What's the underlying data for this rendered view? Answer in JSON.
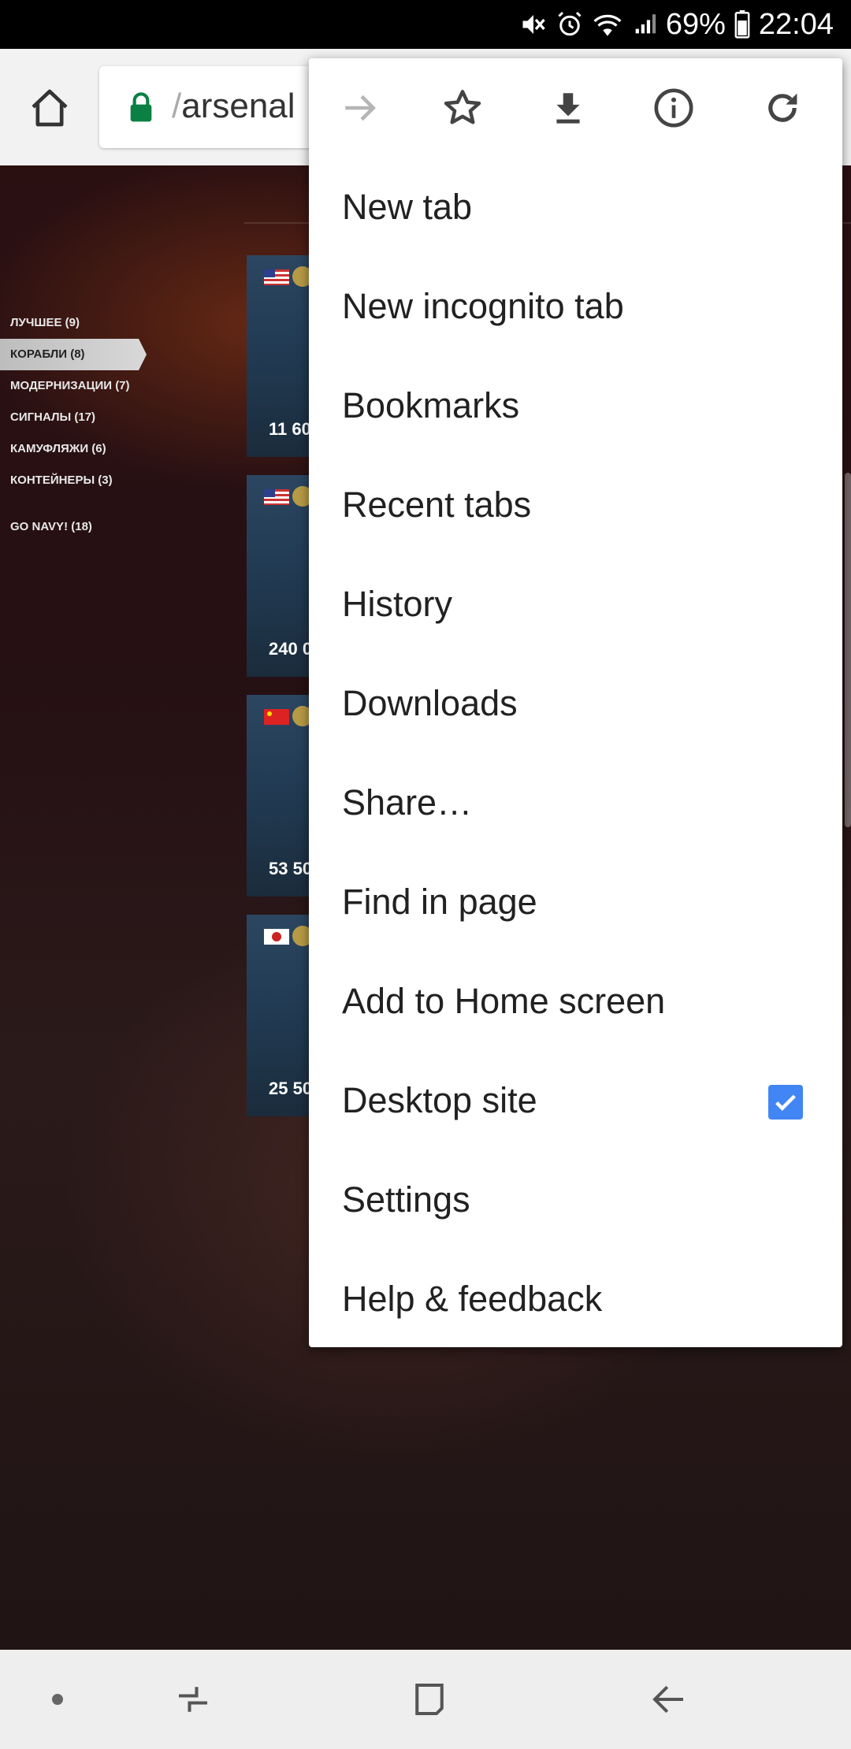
{
  "status": {
    "battery": "69%",
    "time": "22:04"
  },
  "toolbar": {
    "url_prefix": "/",
    "url_rest": "arsenal"
  },
  "page": {
    "categories": [
      {
        "label": "ЛУЧШЕЕ (9)",
        "active": false
      },
      {
        "label": "КОРАБЛИ (8)",
        "active": true
      },
      {
        "label": "МОДЕРНИЗАЦИИ (7)",
        "active": false
      },
      {
        "label": "СИГНАЛЫ (17)",
        "active": false
      },
      {
        "label": "КАМУФЛЯЖИ (6)",
        "active": false
      },
      {
        "label": "КОНТЕЙНЕРЫ (3)",
        "active": false
      }
    ],
    "special_category": "GO NAVY! (18)",
    "cards": [
      {
        "price": "11 60",
        "flag": "us"
      },
      {
        "price": "240 0",
        "flag": "us"
      },
      {
        "price": "53 50",
        "flag": "cn"
      },
      {
        "price": "25 50",
        "flag": "jp"
      }
    ]
  },
  "menu": {
    "icons": [
      "forward-icon",
      "bookmark-star-icon",
      "download-icon",
      "info-icon",
      "reload-icon"
    ],
    "items": [
      {
        "label": "New tab"
      },
      {
        "label": "New incognito tab"
      },
      {
        "label": "Bookmarks"
      },
      {
        "label": "Recent tabs"
      },
      {
        "label": "History"
      },
      {
        "label": "Downloads"
      },
      {
        "label": "Share…"
      },
      {
        "label": "Find in page"
      },
      {
        "label": "Add to Home screen"
      },
      {
        "label": "Desktop site",
        "checked": true
      },
      {
        "label": "Settings"
      },
      {
        "label": "Help & feedback"
      }
    ]
  },
  "colors": {
    "checkbox": "#4285f4",
    "lock": "#0b8043"
  }
}
